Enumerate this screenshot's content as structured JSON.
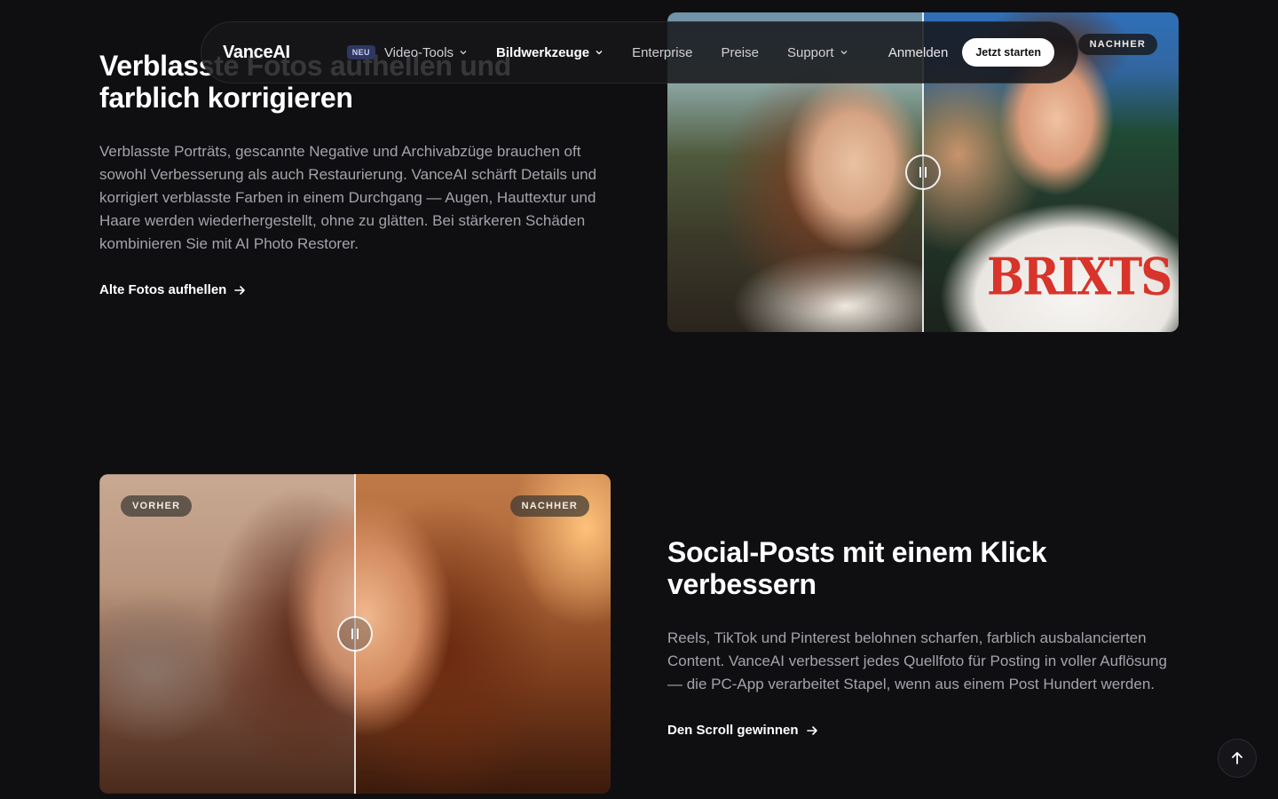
{
  "nav": {
    "logo": "VanceAI",
    "badge": "NEU",
    "items": [
      {
        "label": "Video-Tools",
        "dropdown": true
      },
      {
        "label": "Bildwerkzeuge",
        "dropdown": true,
        "active": true
      },
      {
        "label": "Enterprise",
        "dropdown": false
      },
      {
        "label": "Preise",
        "dropdown": false
      },
      {
        "label": "Support",
        "dropdown": true
      }
    ],
    "login": "Anmelden",
    "cta": "Jetzt starten"
  },
  "section1": {
    "title_line1": "Verblasste Fotos aufhellen und",
    "title_line2": "farblich korrigieren",
    "body": "Verblasste Porträts, gescannte Negative und Archivabzüge brauchen oft sowohl Verbesserung als auch Restaurierung. VanceAI schärft Details und korrigiert verblasste Farben in einem Durchgang — Augen, Hauttextur und Haare werden wiederhergestellt, ohne zu glätten. Bei stärkeren Schäden kombinieren Sie mit AI Photo Restorer.",
    "link": "Alte Fotos aufhellen",
    "image": {
      "after_label": "NACHHER",
      "shirt_print": "BRIXTS"
    }
  },
  "section2": {
    "title": "Social-Posts mit einem Klick verbessern",
    "body": "Reels, TikTok und Pinterest belohnen scharfen, farblich ausbalancierten Content. VanceAI verbessert jedes Quellfoto für Posting in voller Auflösung — die PC-App verarbeitet Stapel, wenn aus einem Post Hundert werden.",
    "link": "Den Scroll gewinnen",
    "image": {
      "before_label": "VORHER",
      "after_label": "NACHHER"
    }
  },
  "icons": {
    "chevron": "chevron-down-icon",
    "arrow": "arrow-right-icon",
    "pause": "pause-icon",
    "to_top": "arrow-up-icon"
  }
}
